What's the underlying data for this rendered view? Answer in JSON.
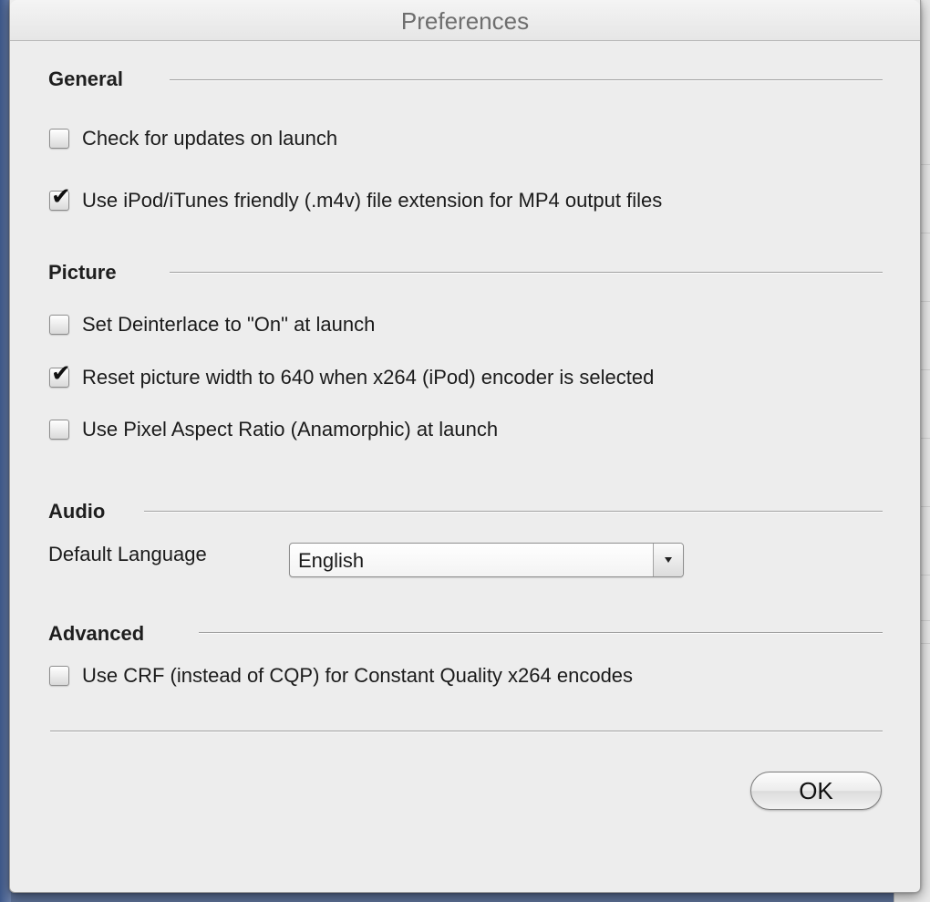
{
  "window": {
    "title": "Preferences"
  },
  "sections": {
    "general": {
      "title": "General",
      "options": [
        {
          "label": "Check for updates on launch",
          "checked": false
        },
        {
          "label": "Use iPod/iTunes friendly (.m4v) file extension for MP4 output files",
          "checked": true
        }
      ]
    },
    "picture": {
      "title": "Picture",
      "options": [
        {
          "label": "Set Deinterlace to \"On\" at launch",
          "checked": false
        },
        {
          "label": "Reset picture width to 640 when x264 (iPod) encoder is selected",
          "checked": true
        },
        {
          "label": "Use Pixel Aspect Ratio (Anamorphic) at launch",
          "checked": false
        }
      ]
    },
    "audio": {
      "title": "Audio",
      "default_language_label": "Default Language",
      "default_language_value": "English"
    },
    "advanced": {
      "title": "Advanced",
      "options": [
        {
          "label": "Use CRF (instead of CQP) for Constant Quality x264 encodes",
          "checked": false
        }
      ]
    }
  },
  "buttons": {
    "ok_label": "OK"
  },
  "icons": {
    "checkmark": "checkmark-icon",
    "popup_arrow": "chevron-down-icon"
  }
}
